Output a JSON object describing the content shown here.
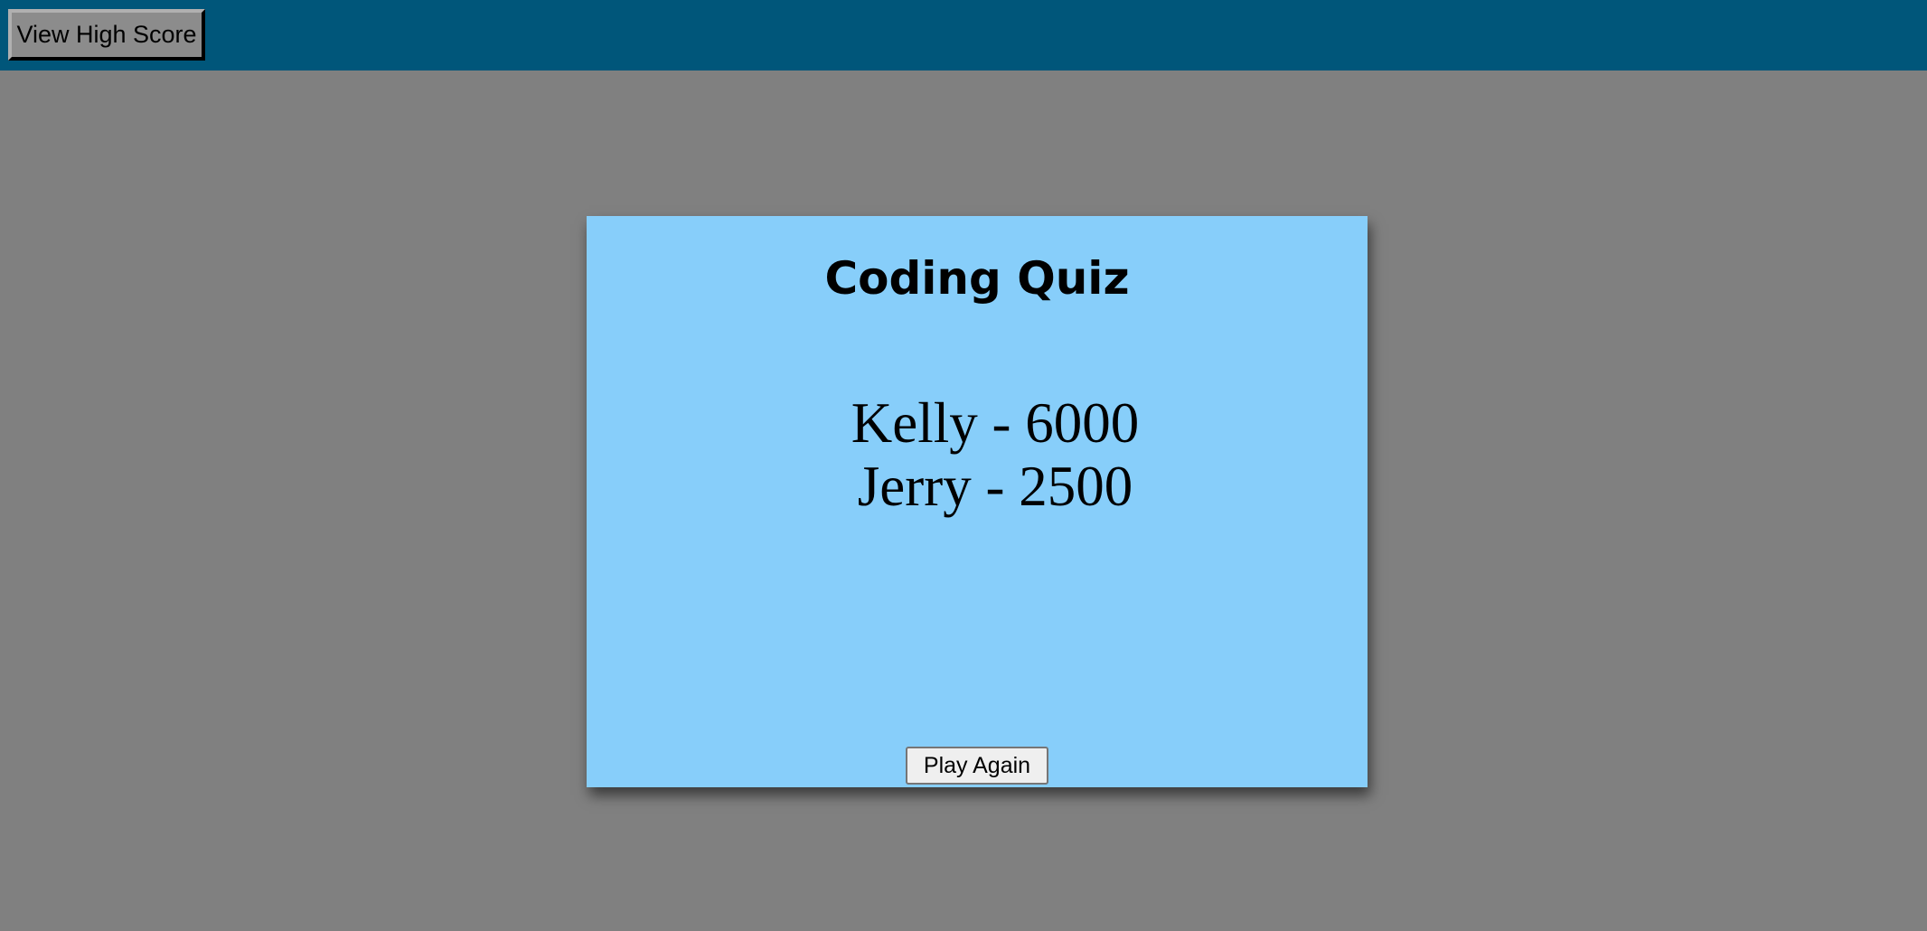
{
  "header": {
    "view_high_score_label": "View High Score"
  },
  "quiz_card": {
    "title": "Coding Quiz",
    "high_scores": [
      {
        "entry": "Kelly - 6000"
      },
      {
        "entry": "Jerry - 2500"
      }
    ],
    "play_again_label": "Play Again"
  },
  "colors": {
    "page_background": "#808080",
    "header_background": "#00567a",
    "card_background": "#87cefa"
  }
}
